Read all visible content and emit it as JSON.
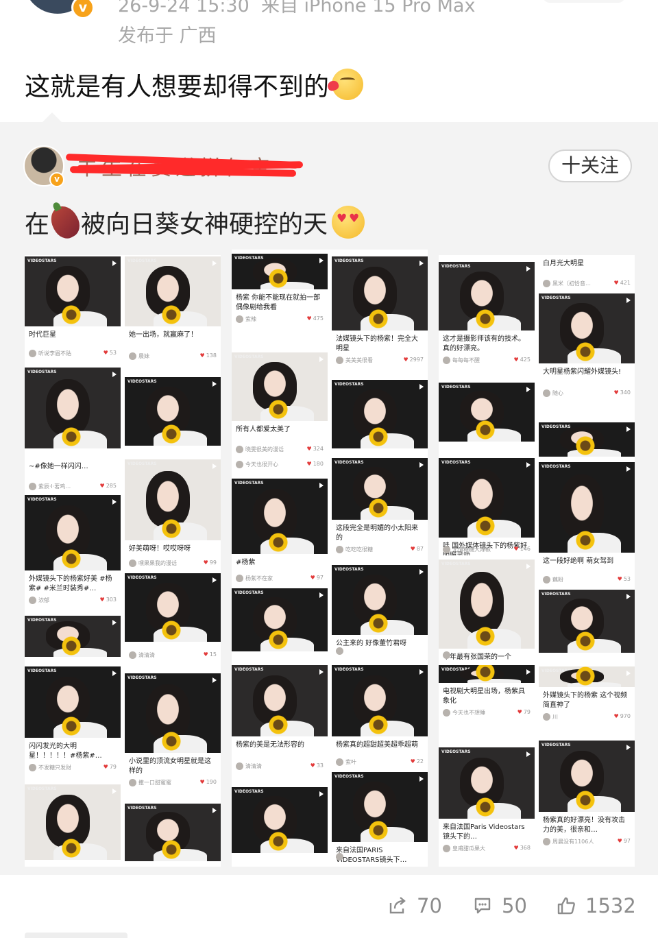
{
  "post": {
    "time": "26-9-24 15:30",
    "device": "来自 iPhone 15 Pro Max",
    "location": "发布于 广西",
    "verified_badge": "v",
    "text": "这就是有人想要却得不到的",
    "emoji": "kissing-heart-emoji"
  },
  "repost": {
    "username": "羊生在赛道拼仨宝",
    "username_redacted": true,
    "verified_badge": "v",
    "follow_label": "十关注",
    "text_prefix": "在",
    "text_suffix": "被向日葵女神硬控的天",
    "emojis": [
      "sweet-potato-emoji",
      "heart-eyes-emoji"
    ]
  },
  "screenshot_feed": {
    "video_brand": "VIDEOSTARS",
    "tiles": [
      {
        "caption": "时代巨星",
        "author": "听说李眉不贴",
        "likes": "53"
      },
      {
        "caption": "她一出场，就赢麻了！",
        "author": "晨妹",
        "likes": "138"
      },
      {
        "caption": "杨紫 你能不能现在就拍一部偶像剧给我看",
        "author": "紫辣",
        "likes": "475"
      },
      {
        "caption": "法媒镜头下的杨紫！完全大明星",
        "author": "美美美很看",
        "likes": "2997"
      },
      {
        "caption": "这才是摄影师该有的技术。真的好漂亮。",
        "author": "每每每不醒",
        "likes": "425"
      },
      {
        "caption": "白月光大明星",
        "author": "黑米（初恰音…",
        "likes": "421"
      },
      {
        "caption": "大明星杨紫闪耀外媒镜头!",
        "author": "随心",
        "likes": "340"
      },
      {
        "caption": "所有人都爱太美了",
        "author": "晓雯很美的漫话",
        "likes": "324"
      },
      {
        "caption": "",
        "author": "今天也很开心",
        "likes": "180"
      },
      {
        "caption": "~#像她一样闪闪…",
        "author": "紫辰·l·著鸡…",
        "likes": "285"
      },
      {
        "caption": "好美萌呀！哎哎呀呀",
        "author": "嘿果果我的漫话",
        "likes": "99"
      },
      {
        "caption": "这段完全是明媚的小太阳来的",
        "author": "吃吃吃很糖",
        "likes": "87"
      },
      {
        "caption": "哇 国外媒体镜头下的杨紫好明媚灵动",
        "author": "无情糖糖大辣椒",
        "likes": "146"
      },
      {
        "caption": "这一段好绝啊 萌女驾到",
        "author": "藕粉",
        "likes": "53"
      },
      {
        "caption": "外媒镜头下的杨紫好美 #杨紫# #米兰时装秀#…",
        "author": "浓郁",
        "likes": "303"
      },
      {
        "caption": "#杨紫",
        "author": "杨紫不在家",
        "likes": "97"
      },
      {
        "caption": "公主来的 好像董竹君呀",
        "author": "",
        "likes": ""
      },
      {
        "caption": "",
        "author": "清清清",
        "likes": "15"
      },
      {
        "caption": "闪闪发光的大明星！！！！！#杨紫#…",
        "author": "不发糖只发财",
        "likes": "79"
      },
      {
        "caption": "小说里的顶流女明星就是这样的",
        "author": "撒一口甜蜜蜜",
        "likes": "190"
      },
      {
        "caption": "杨紫的美是无法形容的",
        "author": "清清清",
        "likes": "33"
      },
      {
        "caption": "杨紫真的超甜超美超乖超萌",
        "author": "紫叶",
        "likes": "22"
      },
      {
        "caption": "电视剧大明星出场，杨紫具象化",
        "author": "今天也不想睡",
        "likes": "79"
      },
      {
        "caption": "外媒镜头下的杨紫 这个视频简直神了",
        "author": "川",
        "likes": "970"
      },
      {
        "caption": "来自法国Paris Videostars镜头下的…",
        "author": "皇甫甜瓜果大",
        "likes": "368"
      },
      {
        "caption": "杨紫真的好漂亮！没有攻击力的美，很亲和…",
        "author": "周晨没有1106人",
        "likes": "97"
      },
      {
        "caption": "来自法国PARIS VIDEOSTARS镜头下…",
        "author": "",
        "likes": ""
      },
      {
        "caption": "今年最有张国荣的一个",
        "author": "",
        "likes": ""
      }
    ]
  },
  "actions": {
    "share_count": "70",
    "comment_count": "50",
    "like_count": "1532"
  }
}
